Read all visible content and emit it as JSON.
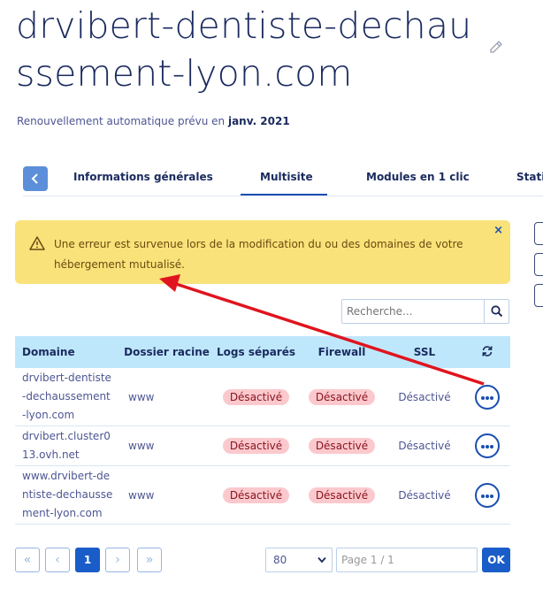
{
  "header": {
    "title": "drvibert-dentiste-dechaussement-lyon.com",
    "renewal_prefix": "Renouvellement automatique prévu en ",
    "renewal_date": "janv. 2021"
  },
  "tabs": [
    {
      "label": "Informations générales"
    },
    {
      "label": "Multisite"
    },
    {
      "label": "Modules en 1 clic"
    },
    {
      "label": "Stati"
    }
  ],
  "alert": {
    "text": "Une erreur est survenue lors de la modification du ou des domaines de votre hébergement mutualisé.",
    "close": "×"
  },
  "search": {
    "placeholder": "Recherche..."
  },
  "table": {
    "headers": {
      "domain": "Domaine",
      "root": "Dossier racine",
      "logs": "Logs séparés",
      "firewall": "Firewall",
      "ssl": "SSL"
    },
    "rows": [
      {
        "domain": [
          "drvibert-dentiste",
          "-dechaussement",
          "-lyon.com"
        ],
        "root": "www",
        "logs": "Désactivé",
        "firewall": "Désactivé",
        "ssl": "Désactivé"
      },
      {
        "domain": [
          "drvibert.cluster0",
          "13.ovh.net"
        ],
        "root": "www",
        "logs": "Désactivé",
        "firewall": "Désactivé",
        "ssl": "Désactivé"
      },
      {
        "domain": [
          "www.drvibert-de",
          "ntiste-dechausse",
          "ment-lyon.com"
        ],
        "root": "www",
        "logs": "Désactivé",
        "firewall": "Désactivé",
        "ssl": "Désactivé"
      }
    ]
  },
  "pagination": {
    "first": "«",
    "prev": "‹",
    "current": "1",
    "next": "›",
    "last": "»",
    "per_page": "80",
    "page_label": "Page 1 / 1",
    "ok": "OK"
  },
  "colors": {
    "alert_bg": "#fae27a",
    "header_bg": "#bfe7fb",
    "badge_bg": "#fbc9cd",
    "primary": "#1a5dc8",
    "annotation_arrow": "#e0141e"
  }
}
